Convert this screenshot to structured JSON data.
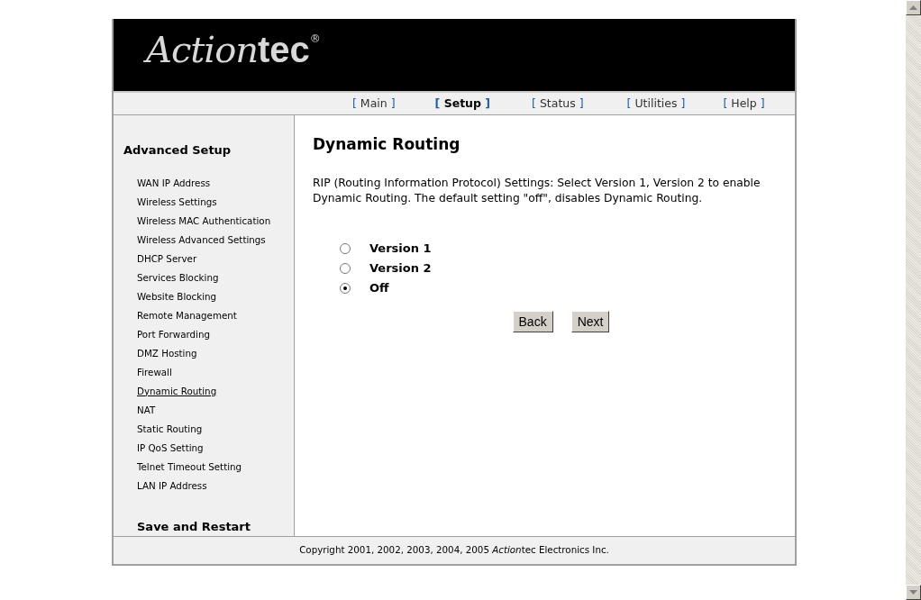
{
  "logo": {
    "script_part": "Action",
    "bold_part": "tec",
    "mark": "®"
  },
  "nav": [
    {
      "label": "Main",
      "selected": false
    },
    {
      "label": "Setup",
      "selected": true
    },
    {
      "label": "Status",
      "selected": false
    },
    {
      "label": "Utilities",
      "selected": false
    },
    {
      "label": "Help",
      "selected": false
    }
  ],
  "nav_brackets": {
    "open": "[",
    "close": "]"
  },
  "sidebar": {
    "heading": "Advanced Setup",
    "items": [
      {
        "label": "WAN IP Address",
        "selected": false
      },
      {
        "label": "Wireless Settings",
        "selected": false
      },
      {
        "label": "Wireless MAC Authentication",
        "selected": false
      },
      {
        "label": "Wireless Advanced Settings",
        "selected": false
      },
      {
        "label": "DHCP Server",
        "selected": false
      },
      {
        "label": "Services Blocking",
        "selected": false
      },
      {
        "label": "Website Blocking",
        "selected": false
      },
      {
        "label": "Remote Management",
        "selected": false
      },
      {
        "label": "Port Forwarding",
        "selected": false
      },
      {
        "label": "DMZ Hosting",
        "selected": false
      },
      {
        "label": "Firewall",
        "selected": false
      },
      {
        "label": "Dynamic Routing",
        "selected": true
      },
      {
        "label": "NAT",
        "selected": false
      },
      {
        "label": "Static Routing",
        "selected": false
      },
      {
        "label": "IP QoS Setting",
        "selected": false
      },
      {
        "label": "Telnet Timeout Setting",
        "selected": false
      },
      {
        "label": "LAN IP Address",
        "selected": false
      }
    ],
    "footer_link": "Save and Restart"
  },
  "content": {
    "title": "Dynamic Routing",
    "description": "RIP (Routing Information Protocol) Settings: Select Version 1, Version 2 to enable Dynamic Routing. The default setting \"off\", disables Dynamic Routing.",
    "options": [
      {
        "label": "Version 1",
        "selected": false
      },
      {
        "label": "Version 2",
        "selected": false
      },
      {
        "label": "Off",
        "selected": true
      }
    ],
    "buttons": [
      "Back",
      "Next"
    ]
  },
  "footer": {
    "before": "Copyright 2001, 2002, 2003, 2004, 2005 ",
    "italic_part": "Action",
    "after": "tec Electronics Inc."
  }
}
